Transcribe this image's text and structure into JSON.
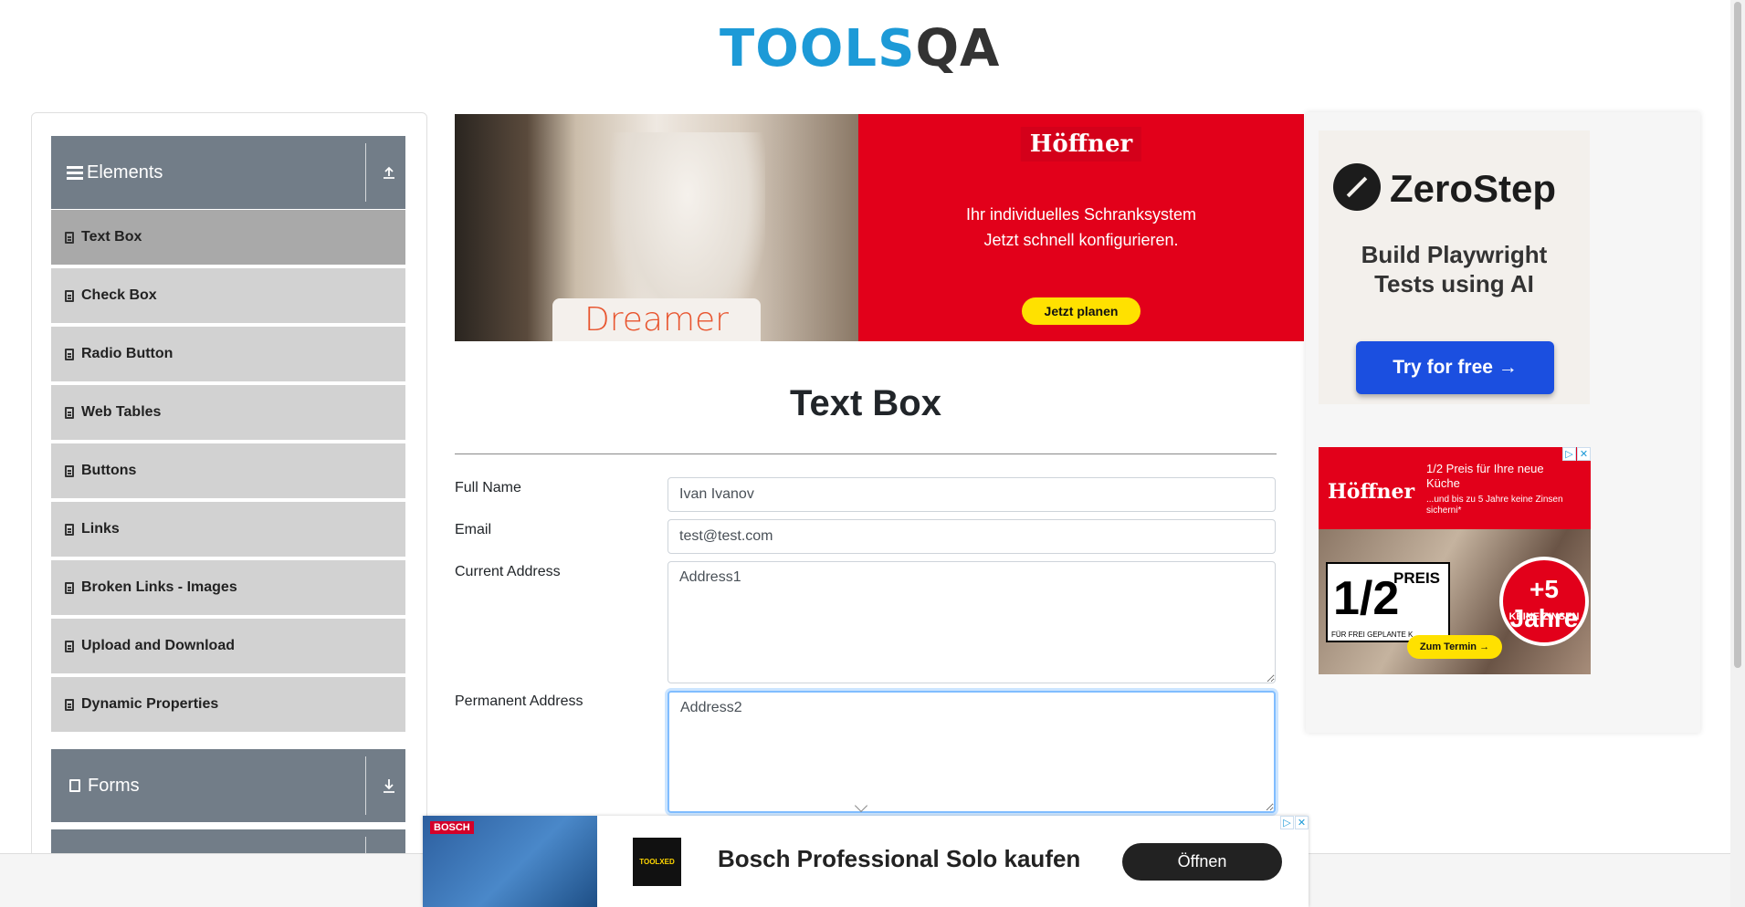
{
  "header": {
    "logo_part1": "TOOLS",
    "logo_part2": "QA"
  },
  "sidebar": {
    "elements_group": {
      "label": "Elements",
      "toggle_icon": "collapse-arrow-up-icon"
    },
    "items": [
      {
        "label": "Text Box",
        "active": true
      },
      {
        "label": "Check Box"
      },
      {
        "label": "Radio Button"
      },
      {
        "label": "Web Tables"
      },
      {
        "label": "Buttons"
      },
      {
        "label": "Links"
      },
      {
        "label": "Broken Links - Images"
      },
      {
        "label": "Upload and Download"
      },
      {
        "label": "Dynamic Properties"
      }
    ],
    "forms_group": {
      "label": "Forms",
      "toggle_icon": "expand-arrow-down-icon"
    }
  },
  "ad_top": {
    "image_caption": "Dreamer",
    "brand": "Höffner",
    "line1": "Ihr individuelles Schranksystem",
    "line2": "Jetzt schnell konfigurieren.",
    "cta": "Jetzt planen",
    "colors": {
      "background": "#e2001a",
      "cta": "#ffe100"
    }
  },
  "ad_zerostep": {
    "brand": "ZeroStep",
    "subtitle_line1": "Build Playwright",
    "subtitle_line2": "Tests using AI",
    "cta": "Try for free →",
    "colors": {
      "cta": "#1b4fe0"
    }
  },
  "ad_hoeffner_side": {
    "brand": "Höffner",
    "headline_line1": "1/2 Preis für Ihre neue",
    "headline_line2": "Küche",
    "subline": "...und bis zu 5 Jahre keine Zinsen sicherni*",
    "half_big": "1/2",
    "half_label": "PREIS",
    "half_footer": "FÜR FREI GEPLANTE K",
    "circle_big": "+5 Jahre",
    "circle_small": "KEINE ZINSEN",
    "cta": "Zum Termin →"
  },
  "form": {
    "title": "Text Box",
    "full_name_label": "Full Name",
    "full_name_value": "Ivan Ivanov",
    "email_label": "Email",
    "email_value": "test@test.com",
    "current_address_label": "Current Address",
    "current_address_value": "Address1",
    "permanent_address_label": "Permanent Address",
    "permanent_address_value": "Address2"
  },
  "ad_bottom": {
    "image_badge": "BOSCH",
    "logo_text": "TOOLXED",
    "title": "Bosch Professional Solo kaufen",
    "cta": "Öffnen"
  },
  "ad_controls": {
    "info": "▷",
    "close": "✕"
  }
}
